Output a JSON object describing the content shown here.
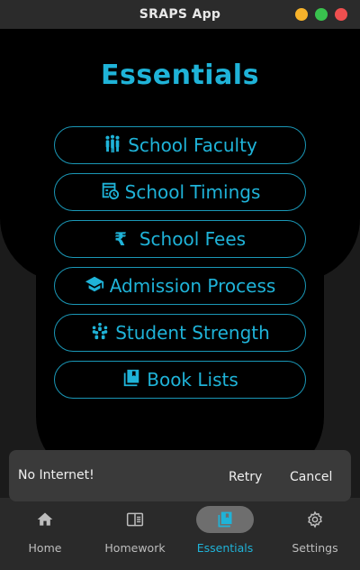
{
  "window": {
    "title": "SRAPS App",
    "buttons": [
      {
        "name": "minimize",
        "color": "#f7b32b"
      },
      {
        "name": "maximize",
        "color": "#39c24e"
      },
      {
        "name": "close",
        "color": "#ee4f4f"
      }
    ]
  },
  "page": {
    "heading": "Essentials"
  },
  "menu": {
    "items": [
      {
        "label": "School Faculty",
        "icon": "people-group-icon"
      },
      {
        "label": "School Timings",
        "icon": "schedule-table-icon"
      },
      {
        "label": "School Fees",
        "icon": "rupee-icon"
      },
      {
        "label": "Admission Process",
        "icon": "graduation-cap-icon"
      },
      {
        "label": "Student Strength",
        "icon": "students-icon"
      },
      {
        "label": "Book Lists",
        "icon": "books-icon"
      }
    ],
    "rupee_symbol": "₹"
  },
  "snackbar": {
    "message": "No Internet!",
    "retry_label": "Retry",
    "cancel_label": "Cancel"
  },
  "nav": {
    "items": [
      {
        "label": "Home",
        "icon": "home-icon",
        "active": false
      },
      {
        "label": "Homework",
        "icon": "book-open-icon",
        "active": false
      },
      {
        "label": "Essentials",
        "icon": "library-books-icon",
        "active": true
      },
      {
        "label": "Settings",
        "icon": "gear-icon",
        "active": false
      }
    ]
  },
  "colors": {
    "accent": "#1fb3d8",
    "border": "#1a97b6",
    "nav_pill": "#6e6e6e",
    "snackbar_bg": "#3a3a3a"
  }
}
